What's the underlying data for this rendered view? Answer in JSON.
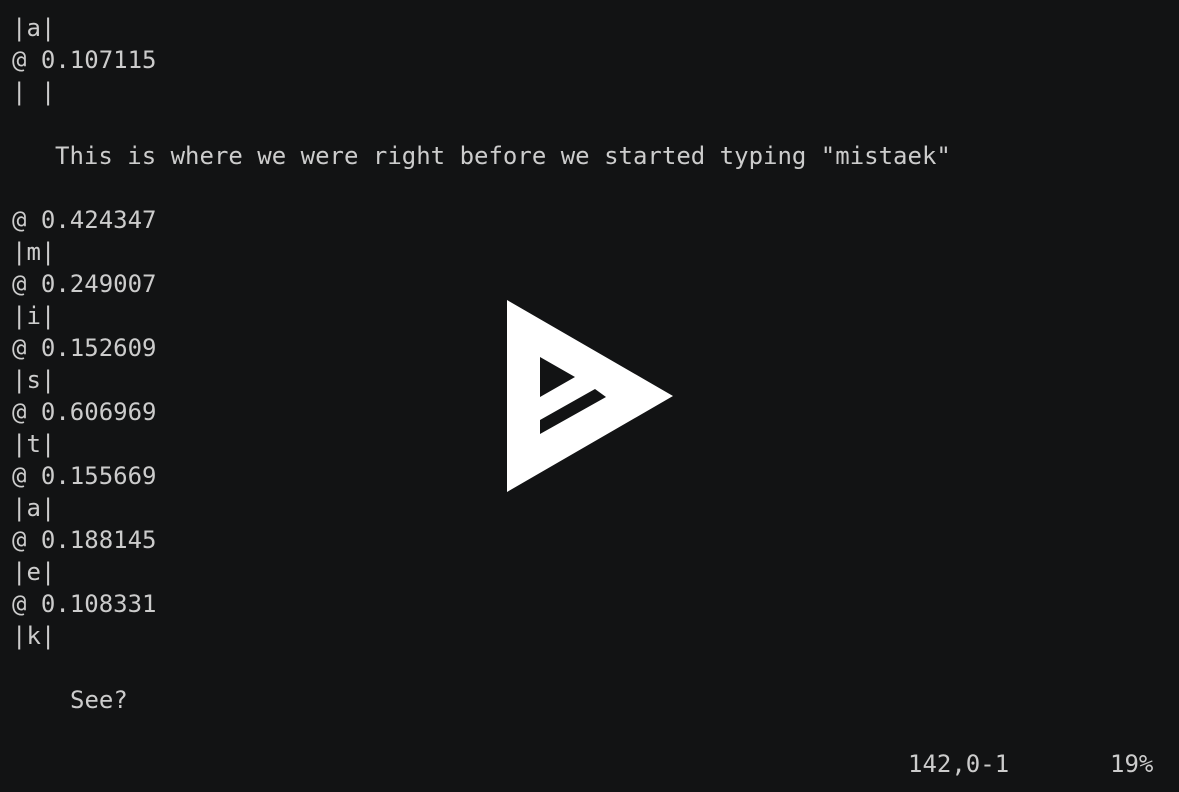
{
  "terminal": {
    "lines": [
      {
        "text": "|a|",
        "indent": 0
      },
      {
        "text": "@ 0.107115",
        "indent": 0
      },
      {
        "text": "| |",
        "indent": 0
      },
      {
        "text": "",
        "indent": 0
      },
      {
        "text": "This is where we were right before we started typing \"mistaek\"",
        "indent": 1
      },
      {
        "text": "",
        "indent": 0
      },
      {
        "text": "@ 0.424347",
        "indent": 0
      },
      {
        "text": "|m|",
        "indent": 0
      },
      {
        "text": "@ 0.249007",
        "indent": 0
      },
      {
        "text": "|i|",
        "indent": 0
      },
      {
        "text": "@ 0.152609",
        "indent": 0
      },
      {
        "text": "|s|",
        "indent": 0
      },
      {
        "text": "@ 0.606969",
        "indent": 0
      },
      {
        "text": "|t|",
        "indent": 0
      },
      {
        "text": "@ 0.155669",
        "indent": 0
      },
      {
        "text": "|a|",
        "indent": 0
      },
      {
        "text": "@ 0.188145",
        "indent": 0
      },
      {
        "text": "|e|",
        "indent": 0
      },
      {
        "text": "@ 0.108331",
        "indent": 0
      },
      {
        "text": "|k|",
        "indent": 0
      },
      {
        "text": "",
        "indent": 0
      },
      {
        "text": "See?",
        "indent": 2
      }
    ]
  },
  "status": {
    "cursor_position": "142,0-1",
    "scroll_percent": "19%"
  },
  "overlay": {
    "icon": "asciinema-play-icon"
  },
  "colors": {
    "background": "#121314",
    "foreground": "#cccccc",
    "overlay": "#ffffff"
  }
}
